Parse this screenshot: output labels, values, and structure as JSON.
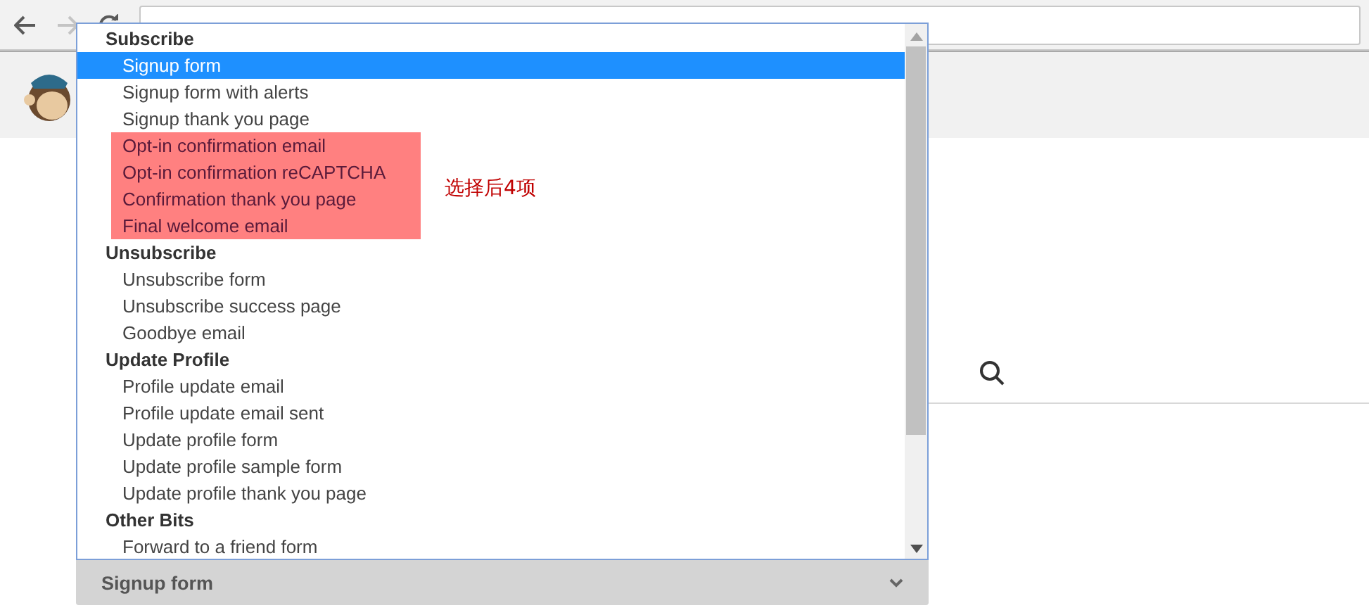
{
  "dropdown": {
    "groups": [
      {
        "label": "Subscribe",
        "options": [
          {
            "label": "Signup form",
            "selected": true,
            "marked": false
          },
          {
            "label": "Signup form with alerts",
            "selected": false,
            "marked": false
          },
          {
            "label": "Signup thank you page",
            "selected": false,
            "marked": false
          },
          {
            "label": "Opt-in confirmation email",
            "selected": false,
            "marked": true
          },
          {
            "label": "Opt-in confirmation reCAPTCHA",
            "selected": false,
            "marked": true
          },
          {
            "label": "Confirmation thank you page",
            "selected": false,
            "marked": true
          },
          {
            "label": "Final welcome email",
            "selected": false,
            "marked": true
          }
        ]
      },
      {
        "label": "Unsubscribe",
        "options": [
          {
            "label": "Unsubscribe form",
            "selected": false,
            "marked": false
          },
          {
            "label": "Unsubscribe success page",
            "selected": false,
            "marked": false
          },
          {
            "label": "Goodbye email",
            "selected": false,
            "marked": false
          }
        ]
      },
      {
        "label": "Update Profile",
        "options": [
          {
            "label": "Profile update email",
            "selected": false,
            "marked": false
          },
          {
            "label": "Profile update email sent",
            "selected": false,
            "marked": false
          },
          {
            "label": "Update profile form",
            "selected": false,
            "marked": false
          },
          {
            "label": "Update profile sample form",
            "selected": false,
            "marked": false
          },
          {
            "label": "Update profile thank you page",
            "selected": false,
            "marked": false
          }
        ]
      },
      {
        "label": "Other Bits",
        "options": [
          {
            "label": "Forward to a friend form",
            "selected": false,
            "marked": false
          }
        ]
      }
    ],
    "value": "Signup form"
  },
  "annotation": "选择后4项"
}
